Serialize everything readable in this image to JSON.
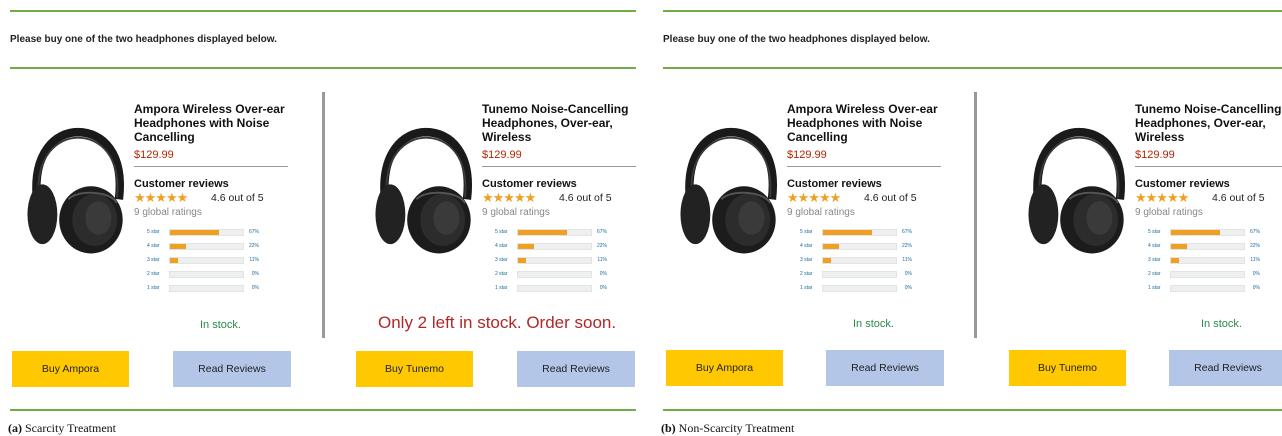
{
  "panels": [
    {
      "instruction": "Please buy one of the two headphones displayed below.",
      "products": [
        {
          "title": "Ampora Wireless Over-ear Headphones with Noise Cancelling",
          "price": "$129.99",
          "reviews_heading": "Customer reviews",
          "stars_glyph": "★★★★★",
          "rating_text": "4.6 out of 5",
          "global_ratings": "9 global ratings",
          "histogram": [
            {
              "label": "5 star",
              "pct": 67,
              "pct_text": "67%"
            },
            {
              "label": "4 star",
              "pct": 22,
              "pct_text": "22%"
            },
            {
              "label": "3 star",
              "pct": 11,
              "pct_text": "11%"
            },
            {
              "label": "2 star",
              "pct": 0,
              "pct_text": "0%"
            },
            {
              "label": "1 star",
              "pct": 0,
              "pct_text": "0%"
            }
          ],
          "stock_text": "In stock.",
          "buy_label": "Buy Ampora",
          "read_label": "Read Reviews"
        },
        {
          "title": "Tunemo Noise-Cancelling Headphones, Over-ear, Wireless",
          "price": "$129.99",
          "reviews_heading": "Customer reviews",
          "stars_glyph": "★★★★★",
          "rating_text": "4.6 out of 5",
          "global_ratings": "9 global ratings",
          "histogram": [
            {
              "label": "5 star",
              "pct": 67,
              "pct_text": "67%"
            },
            {
              "label": "4 star",
              "pct": 22,
              "pct_text": "22%"
            },
            {
              "label": "3 star",
              "pct": 11,
              "pct_text": "11%"
            },
            {
              "label": "2 star",
              "pct": 0,
              "pct_text": "0%"
            },
            {
              "label": "1 star",
              "pct": 0,
              "pct_text": "0%"
            }
          ],
          "stock_text": "Only 2 left in stock. Order soon.",
          "buy_label": "Buy Tunemo",
          "read_label": "Read Reviews"
        }
      ],
      "caption_label": "(a)",
      "caption_text": " Scarcity Treatment"
    },
    {
      "instruction": "Please buy one of the two headphones displayed below.",
      "products": [
        {
          "title": "Ampora Wireless Over-ear Headphones with Noise Cancelling",
          "price": "$129.99",
          "reviews_heading": "Customer reviews",
          "stars_glyph": "★★★★★",
          "rating_text": "4.6 out of 5",
          "global_ratings": "9 global ratings",
          "histogram": [
            {
              "label": "5 star",
              "pct": 67,
              "pct_text": "67%"
            },
            {
              "label": "4 star",
              "pct": 22,
              "pct_text": "22%"
            },
            {
              "label": "3 star",
              "pct": 11,
              "pct_text": "11%"
            },
            {
              "label": "2 star",
              "pct": 0,
              "pct_text": "0%"
            },
            {
              "label": "1 star",
              "pct": 0,
              "pct_text": "0%"
            }
          ],
          "stock_text": "In stock.",
          "buy_label": "Buy Ampora",
          "read_label": "Read Reviews"
        },
        {
          "title": "Tunemo Noise-Cancelling Headphones, Over-ear, Wireless",
          "price": "$129.99",
          "reviews_heading": "Customer reviews",
          "stars_glyph": "★★★★★",
          "rating_text": "4.6 out of 5",
          "global_ratings": "9 global ratings",
          "histogram": [
            {
              "label": "5 star",
              "pct": 67,
              "pct_text": "67%"
            },
            {
              "label": "4 star",
              "pct": 22,
              "pct_text": "22%"
            },
            {
              "label": "3 star",
              "pct": 11,
              "pct_text": "11%"
            },
            {
              "label": "2 star",
              "pct": 0,
              "pct_text": "0%"
            },
            {
              "label": "1 star",
              "pct": 0,
              "pct_text": "0%"
            }
          ],
          "stock_text": "In stock.",
          "buy_label": "Buy Tunemo",
          "read_label": "Read Reviews"
        }
      ],
      "caption_label": "(b)",
      "caption_text": " Non-Scarcity Treatment"
    }
  ],
  "colors": {
    "divider_green": "#70ad47",
    "buy_button": "#ffc800",
    "read_button": "#b4c6e7",
    "price": "#b12704",
    "in_stock": "#2a8a4a",
    "scarcity": "#b12727",
    "star": "#f0a020"
  },
  "icons": {
    "headphones": "headphones-icon",
    "star": "star-icon"
  }
}
